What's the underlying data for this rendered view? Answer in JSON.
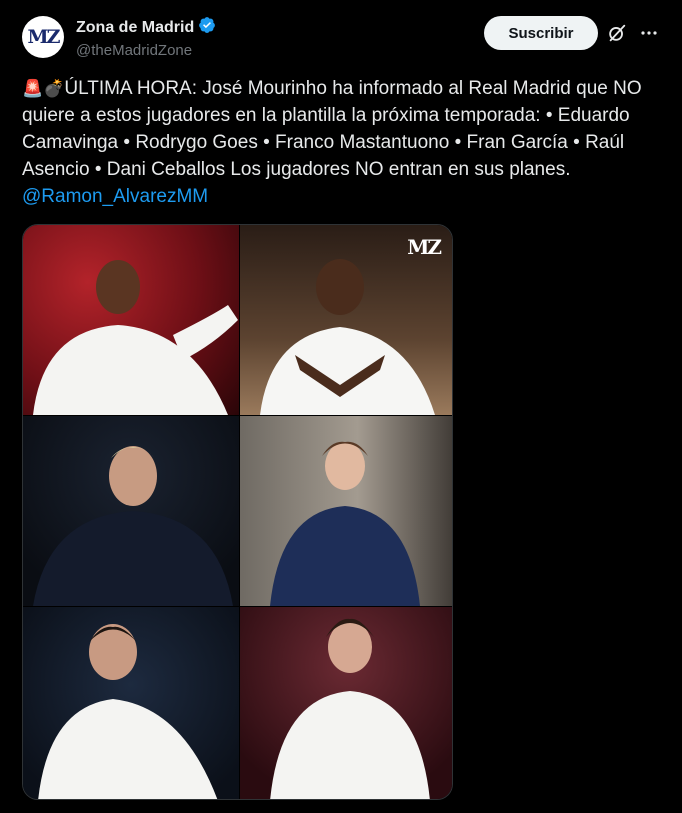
{
  "author": {
    "avatar_text": "MZ",
    "display_name": "Zona de Madrid",
    "handle": "@theMadridZone",
    "verified_color": "#1d9bf0"
  },
  "actions": {
    "follow_label": "Suscribir",
    "grok_icon": "grok-icon",
    "more_icon": "more-icon"
  },
  "tweet": {
    "emoji": "🚨💣",
    "body": "ÚLTIMA HORA: José Mourinho ha informado al Real Madrid que NO quiere a estos jugadores en la plantilla la próxima temporada: • Eduardo Camavinga • Rodrygo Goes • Franco Mastantuono • Fran García • Raúl Asencio • Dani Ceballos Los jugadores NO entran en sus planes.",
    "mention": "@Ramon_AlvarezMM"
  },
  "media": {
    "watermark": "MZ",
    "photos": [
      {
        "subject": "player-photo-1"
      },
      {
        "subject": "player-photo-2"
      },
      {
        "subject": "player-photo-3"
      },
      {
        "subject": "player-photo-4"
      },
      {
        "subject": "player-photo-5"
      },
      {
        "subject": "player-photo-6"
      }
    ]
  },
  "colors": {
    "background": "#000000",
    "text": "#e7e9ea",
    "muted": "#71767b",
    "link": "#1d9bf0",
    "button_bg": "#eff3f4"
  }
}
